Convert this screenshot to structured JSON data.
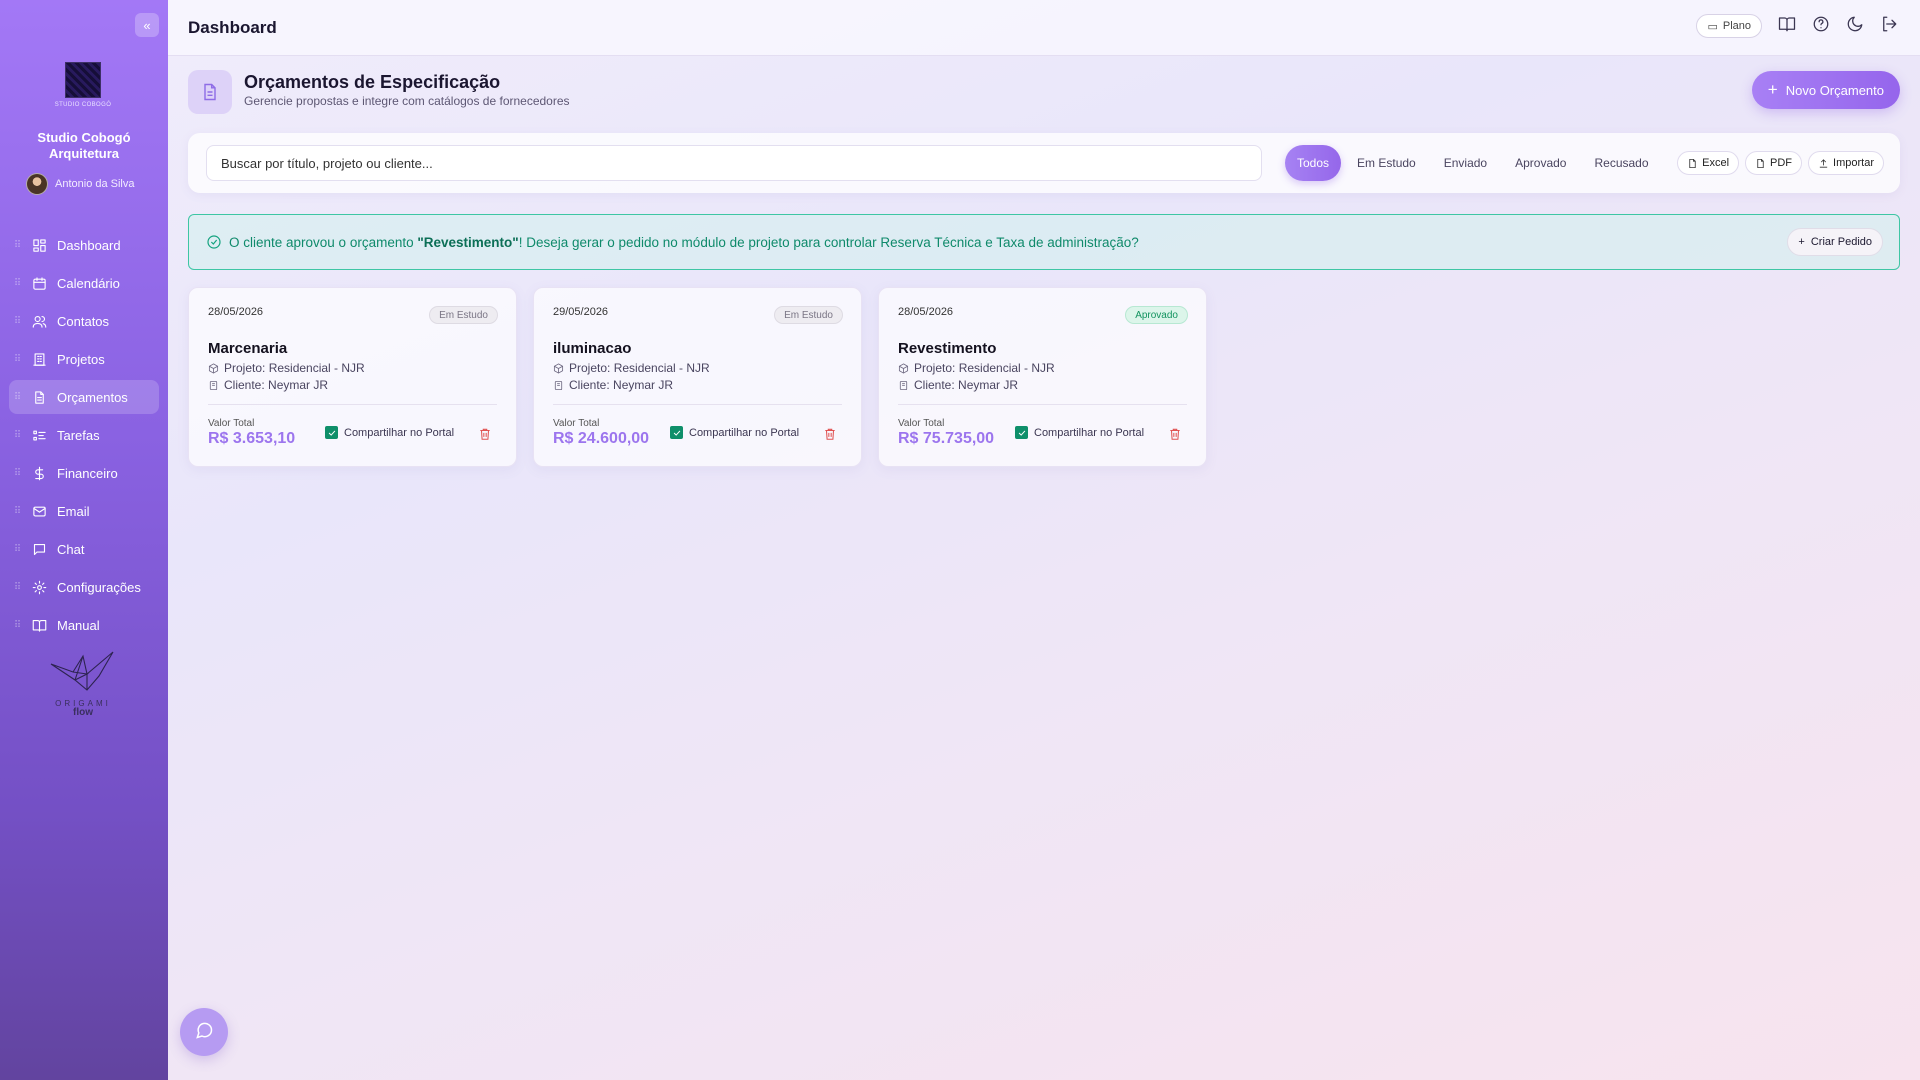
{
  "sidebar": {
    "logo_text": "STUDIO COBOGÓ",
    "studio_name": "Studio Cobogó Arquitetura",
    "user_name": "Antonio da Silva",
    "items": [
      {
        "label": "Dashboard",
        "icon": "dashboard-icon"
      },
      {
        "label": "Calendário",
        "icon": "calendar-icon"
      },
      {
        "label": "Contatos",
        "icon": "contacts-icon"
      },
      {
        "label": "Projetos",
        "icon": "projects-icon"
      },
      {
        "label": "Orçamentos",
        "icon": "document-icon",
        "active": true
      },
      {
        "label": "Tarefas",
        "icon": "tasks-icon"
      },
      {
        "label": "Financeiro",
        "icon": "dollar-icon"
      },
      {
        "label": "Email",
        "icon": "mail-icon"
      },
      {
        "label": "Chat",
        "icon": "chat-icon"
      },
      {
        "label": "Configurações",
        "icon": "gear-icon"
      },
      {
        "label": "Manual",
        "icon": "book-icon"
      }
    ],
    "brand_line1": "ORIGAMI",
    "brand_line2": "flow"
  },
  "topbar": {
    "title": "Dashboard",
    "plan_label": "Plano"
  },
  "header": {
    "title": "Orçamentos de Especificação",
    "subtitle": "Gerencie propostas e integre com catálogos de fornecedores",
    "new_button": "Novo Orçamento"
  },
  "filters": {
    "search_placeholder": "Buscar por título, projeto ou cliente...",
    "tabs": [
      "Todos",
      "Em Estudo",
      "Enviado",
      "Aprovado",
      "Recusado"
    ],
    "active_tab": "Todos",
    "excel": "Excel",
    "pdf": "PDF",
    "importar": "Importar"
  },
  "alert": {
    "prefix": "O cliente aprovou o orçamento ",
    "highlight": "\"Revestimento\"",
    "suffix": "! Deseja gerar o pedido no módulo de projeto para controlar Reserva Técnica e Taxa de administração?",
    "button": "Criar Pedido",
    "color": "#14a37f"
  },
  "cards": [
    {
      "date": "28/05/2026",
      "status": "Em Estudo",
      "title": "Marcenaria",
      "project": "Projeto: Residencial - NJR",
      "client": "Cliente: Neymar JR",
      "value_label": "Valor Total",
      "value": "R$ 3.653,10",
      "share_label": "Compartilhar no Portal",
      "shared": true
    },
    {
      "date": "29/05/2026",
      "status": "Em Estudo",
      "title": "iluminacao",
      "project": "Projeto: Residencial - NJR",
      "client": "Cliente: Neymar JR",
      "value_label": "Valor Total",
      "value": "R$ 24.600,00",
      "share_label": "Compartilhar no Portal",
      "shared": true
    },
    {
      "date": "28/05/2026",
      "status": "Aprovado",
      "title": "Revestimento",
      "project": "Projeto: Residencial - NJR",
      "client": "Cliente: Neymar JR",
      "value_label": "Valor Total",
      "value": "R$ 75.735,00",
      "share_label": "Compartilhar no Portal",
      "shared": true
    }
  ],
  "colors": {
    "accent": "#9c75ee",
    "sidebar_top": "#a378f6",
    "sidebar_bottom": "#62449f",
    "success": "#0f8f6a",
    "danger": "#e05151"
  }
}
